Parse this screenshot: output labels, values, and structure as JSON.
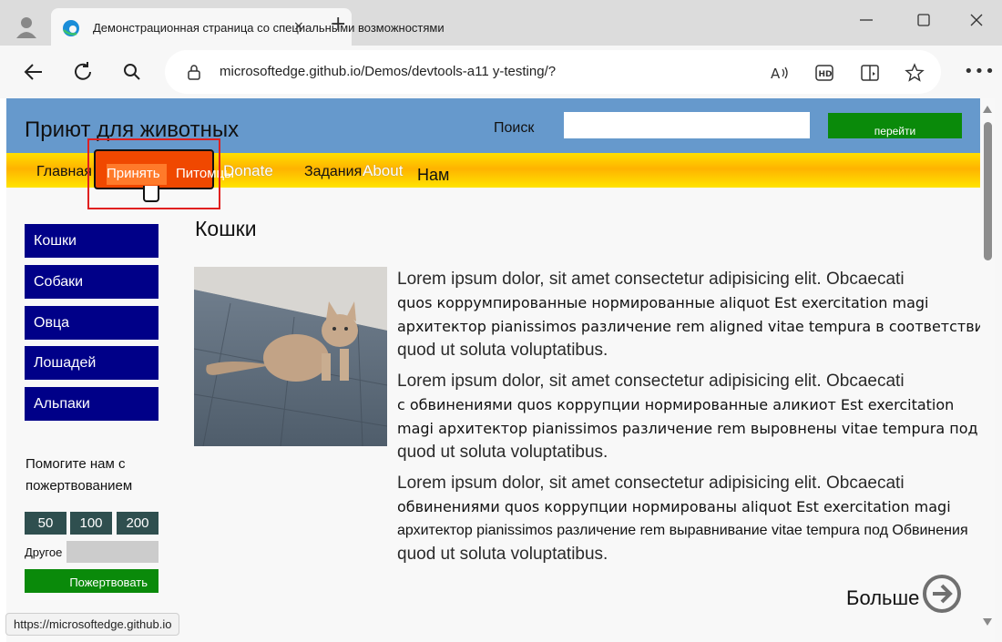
{
  "browser": {
    "tab_title": "Демонстрационная страница со специальными возможностями",
    "tab_close": "×",
    "new_tab": "+",
    "url": "microsoftedge.github.io/Demos/devtools-a11 y-testing/?",
    "status_url": "https://microsoftedge.github.io",
    "icons": [
      "profile-icon",
      "edge-icon",
      "back-icon",
      "refresh-icon",
      "search-icon",
      "lock-icon",
      "read-aloud-icon",
      "hd-icon",
      "immersive-reader-icon",
      "favorite-icon",
      "more-icon",
      "minimize-icon",
      "maximize-icon",
      "close-icon"
    ]
  },
  "site": {
    "title": "Приют для животных",
    "search_label": "Поиск",
    "search_value": "",
    "search_button": "перейти",
    "nav": {
      "home": "Главная",
      "adopt": "Принять",
      "pets": "Питомцы",
      "donate": "Donate",
      "tasks": "Задания",
      "about": "About",
      "us": "Нам"
    },
    "sidebar": [
      "Кошки",
      "Собаки",
      "Овца",
      "Лошадей",
      "Альпаки"
    ],
    "donation": {
      "text": "Помогите нам с пожертвованием",
      "amounts": [
        "50",
        "100",
        "200"
      ],
      "other_label": "Другое",
      "other_value": "",
      "button": "Пожертвовать"
    },
    "content": {
      "heading": "Кошки",
      "paragraphs": [
        [
          "Lorem ipsum dolor, sit amet consectetur adipisicing elit. Obcaecati",
          "quos коррумпированные нормированные aliquot Est exercitation magi",
          "архитектор pianissimos различение rem aligned vitae tempura в соответствии",
          "quod ut soluta voluptatibus."
        ],
        [
          "Lorem ipsum dolor, sit amet consectetur adipisicing elit. Obcaecati",
          "с обвинениями quos коррупции нормированные аликиот Est exercitation",
          "magi архитектор pianissimos различение rem выровнены vitae tempura под",
          "quod ut soluta voluptatibus."
        ],
        [
          "Lorem ipsum dolor, sit amet consectetur adipisicing elit. Obcaecati",
          "обвинениями quos коррупции нормированы aliquot Est exercitation magi",
          "архитектор pianissimos различение rem выравнивание vitae tempura под Обвинения",
          "quod ut soluta voluptatibus."
        ]
      ],
      "more": "Больше"
    }
  },
  "colors": {
    "header": "#6699cc",
    "nav_gradient": [
      "#ffdf00",
      "#ffb300"
    ],
    "sidebar_button": "#000088",
    "green_button": "#0a8a0a",
    "amount_button": "#2f4f4f",
    "tooltip": "#f04800",
    "focus_outline": "#e02020"
  }
}
